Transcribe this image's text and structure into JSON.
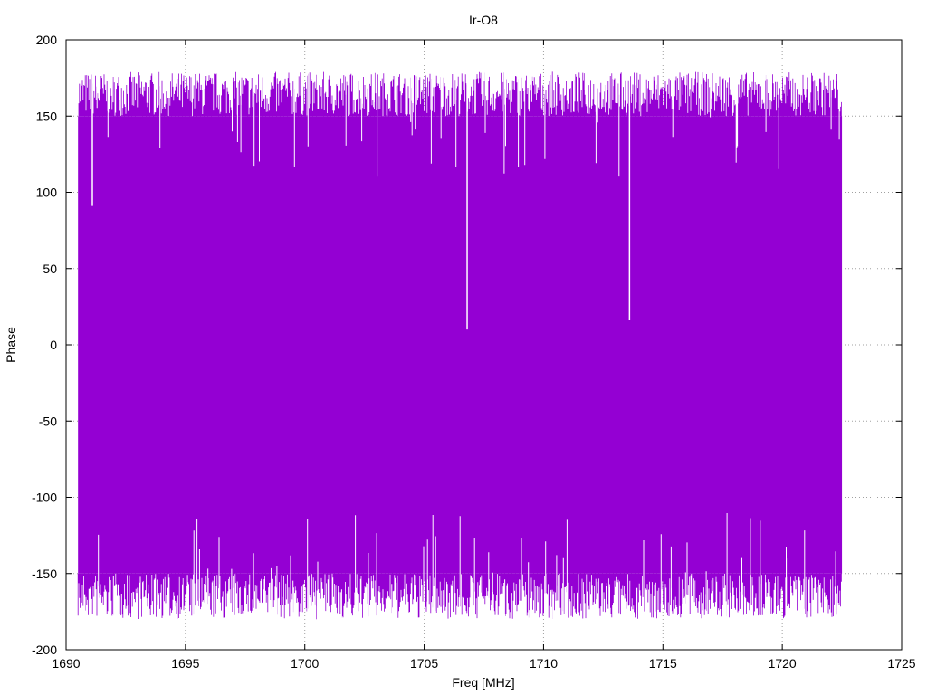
{
  "chart_data": {
    "type": "line",
    "title": "Ir-O8",
    "xlabel": "Freq [MHz]",
    "ylabel": "Phase",
    "xlim": [
      1690,
      1725
    ],
    "ylim": [
      -200,
      200
    ],
    "xticks": [
      1690,
      1695,
      1700,
      1705,
      1710,
      1715,
      1720,
      1725
    ],
    "yticks": [
      -200,
      -150,
      -100,
      -50,
      0,
      50,
      100,
      150,
      200
    ],
    "grid": true,
    "legend": "none",
    "series_color": "#9400D3",
    "series": [
      {
        "x_range": [
          1690.5,
          1722.5
        ],
        "y_range": [
          -180,
          180
        ],
        "description_values": {
          "notable_spikes": [
            {
              "x": 1706.8,
              "y": 10
            },
            {
              "x": 1713.6,
              "y": 16
            },
            {
              "x": 1691.1,
              "y": 91
            }
          ]
        }
      }
    ]
  }
}
